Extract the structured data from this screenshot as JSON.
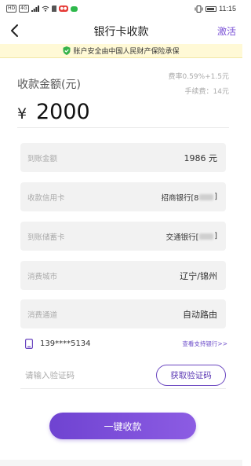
{
  "status_bar": {
    "chip_a": "HD",
    "chip_b": "4G",
    "time": "11:15",
    "icons": [
      "hd-icon",
      "signal-icon",
      "wifi-icon",
      "sim-icon",
      "app-notification-icon",
      "wechat-icon",
      "vibrate-icon",
      "battery-icon"
    ]
  },
  "nav": {
    "title": "银行卡收款",
    "right_action": "激活",
    "back_icon": "back-arrow-icon"
  },
  "notice": {
    "text": "账户安全由中国人民财产保险承保",
    "icon": "shield-check-icon",
    "icon_color": "#37b34a"
  },
  "amount": {
    "label": "收款金额(元)",
    "fee_rate": "费率0.59%+1.5元",
    "fee_charge": "手续费：14元",
    "currency": "¥",
    "value": "2000"
  },
  "rows": [
    {
      "label": "到账金额",
      "value": "1986 元"
    },
    {
      "label": "收款信用卡",
      "value": "招商银行[8",
      "value_end": "]"
    },
    {
      "label": "到账储蓄卡",
      "value": "交通银行[",
      "value_end": "]"
    },
    {
      "label": "消费城市",
      "value": "辽宁/锦州"
    },
    {
      "label": "消费通道",
      "value": "自动路由"
    }
  ],
  "phone": {
    "number": "139****5134",
    "icon": "phone-icon",
    "link": "查看支持银行>>"
  },
  "verify": {
    "placeholder": "请输入验证码",
    "button": "获取验证码"
  },
  "submit": {
    "label": "一键收款"
  },
  "colors": {
    "accent": "#7b52d6",
    "button_gradient_start": "#6f43d1",
    "button_gradient_end": "#8c5ce3",
    "notice_bg": "#fff9d6",
    "row_bg": "#f2f2f2"
  }
}
